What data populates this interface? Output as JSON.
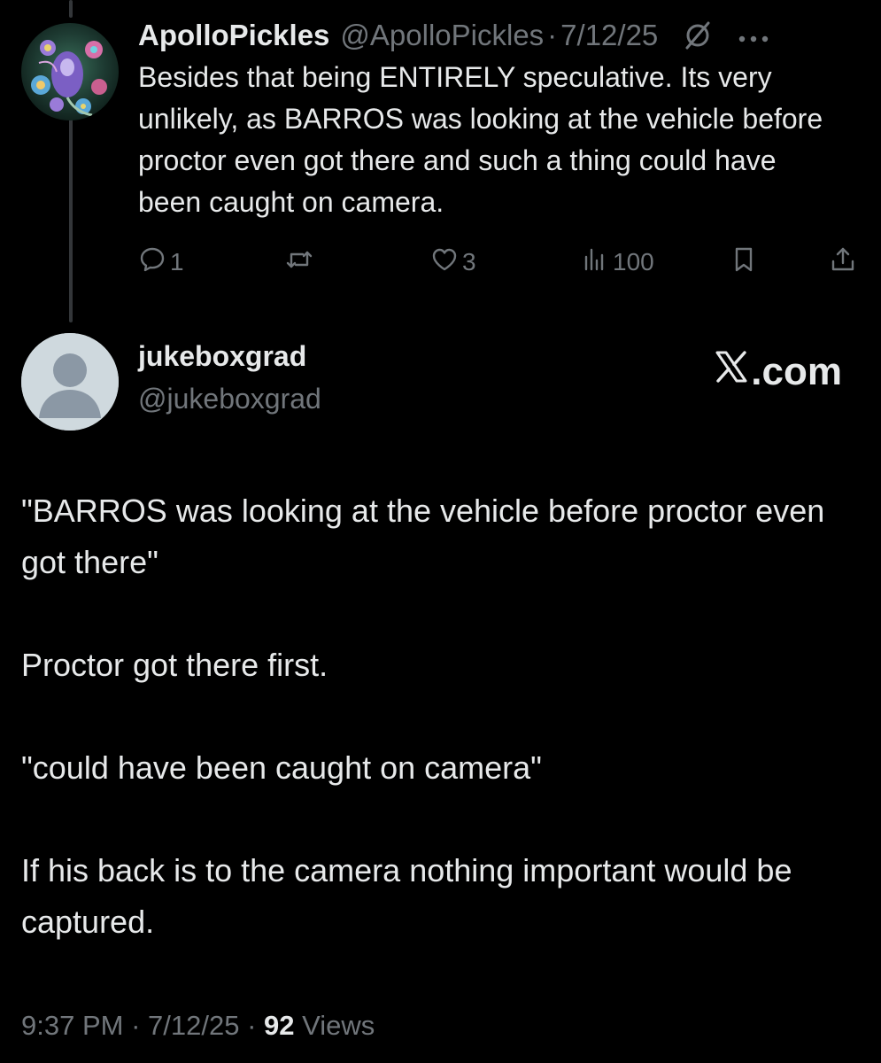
{
  "parent_tweet": {
    "display_name": "ApolloPickles",
    "handle": "@ApolloPickles",
    "separator": "·",
    "date": "7/12/25",
    "text": "Besides that being ENTIRELY speculative. Its very unlikely, as BARROS was looking at the vehicle before proctor even got there and such a thing could have been caught on camera.",
    "icons": {
      "avatar": "psychedelic-art-avatar",
      "grok": "grok-icon",
      "more": "more-icon"
    },
    "actions": {
      "reply_count": "1",
      "retweet_count": "",
      "like_count": "3",
      "view_count": "100"
    }
  },
  "reply_tweet": {
    "display_name": "jukeboxgrad",
    "handle": "@jukeboxgrad",
    "brand": ".com",
    "paragraphs": [
      "\"BARROS was looking at the vehicle before proctor even got there\"",
      "Proctor got there first.",
      "\"could have been caught on camera\"",
      "If his back is to the camera nothing important would be captured."
    ],
    "meta": {
      "time": "9:37 PM",
      "separator": "·",
      "date": "7/12/25",
      "views_count": "92",
      "views_label": "Views"
    }
  },
  "colors": {
    "background": "#000000",
    "text_primary": "#e7e9ea",
    "text_secondary": "#71767b",
    "thread_line": "#333639",
    "default_avatar_bg": "#cfd9de",
    "default_avatar_fg": "#8b98a5"
  }
}
